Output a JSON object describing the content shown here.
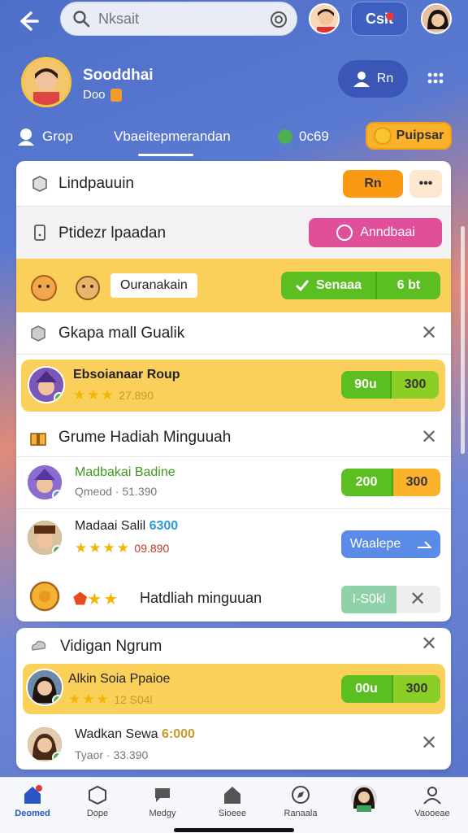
{
  "header": {
    "search_placeholder": "Nksait",
    "notif_label": "Csit"
  },
  "profile": {
    "name": "Sooddhai",
    "sub": "Doo",
    "follow_label": "Rn"
  },
  "tabs": [
    {
      "label": "Grop"
    },
    {
      "label": "Vbaeitepmerandan"
    },
    {
      "label": "0c69"
    }
  ],
  "premium_label": "Puipsar",
  "card1": {
    "row1": {
      "title": "Lindpauuin",
      "btn_label": "Rn",
      "more_label": "•••"
    },
    "row2": {
      "title": "Ptidezr lpaadan",
      "btn_label": "Anndbaai"
    },
    "row3": {
      "chip_label": "Ouranakain",
      "btn_label": "Senaaa",
      "btn2_label": "6 bt"
    },
    "row4": {
      "title": "Gkapa mall Gualik"
    },
    "row5": {
      "name": "Ebsoianaar Roup",
      "meta": "27.890",
      "btn_a": "90u",
      "btn_b": "300"
    },
    "row6": {
      "title": "Grume Hadiah Minguuah"
    },
    "row7": {
      "name": "Madbakai Badine",
      "meta": "Qmeod · 51.390",
      "btn_a": "200",
      "btn_b": "300"
    },
    "row8": {
      "name": "Madaai Salil",
      "tag": "6300",
      "meta": "09.890",
      "btn_label": "Waalepe"
    },
    "row9": {
      "title": "Hatdliah minguuan",
      "btn_label": "I-S0kl"
    }
  },
  "card2": {
    "row1": {
      "title": "Vidigan Ngrum"
    },
    "row2": {
      "name": "Alkin Soia Ppaioe",
      "meta": "12 S04l",
      "btn_a": "00u",
      "btn_b": "300"
    },
    "row3": {
      "name": "Wadkan Sewa",
      "tag": "6:000",
      "meta": "Tyaor · 33.390"
    }
  },
  "bottom_nav": [
    {
      "label": "Deomed",
      "icon": "home-icon"
    },
    {
      "label": "Dope",
      "icon": "box-icon"
    },
    {
      "label": "Medgy",
      "icon": "chat-icon"
    },
    {
      "label": "Sioeee",
      "icon": "house-icon"
    },
    {
      "label": "Ranaala",
      "icon": "compass-icon"
    },
    {
      "label": "",
      "icon": "avatar"
    },
    {
      "label": "Vaooeae",
      "icon": "people-icon"
    }
  ],
  "colors": {
    "accent_orange": "#fbb22a",
    "accent_green": "#5bbf21",
    "accent_pink": "#e04f9a",
    "accent_blue": "#5a8be6"
  }
}
